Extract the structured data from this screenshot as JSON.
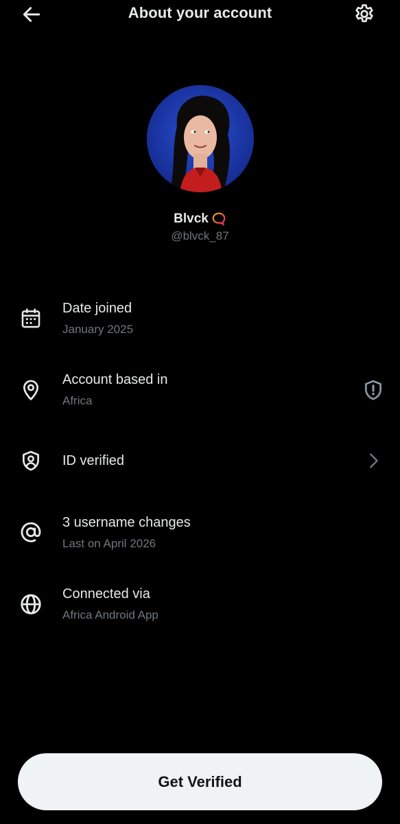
{
  "header": {
    "title": "About your account",
    "back_icon": "arrow-left-icon",
    "settings_icon": "gear-icon"
  },
  "profile": {
    "display_name": "Blvck",
    "name_badge_icon": "speech-bubble-emoji-icon",
    "username": "@blvck_87"
  },
  "details": [
    {
      "icon": "calendar-icon",
      "label": "Date joined",
      "sub": "January 2025"
    },
    {
      "icon": "location-pin-icon",
      "label": "Account based in",
      "sub": "Africa",
      "trailing_icon": "shield-alert-icon"
    },
    {
      "icon": "shield-user-icon",
      "label": "ID verified",
      "trailing_icon": "chevron-right-icon"
    },
    {
      "icon": "at-sign-icon",
      "label": "3 username changes",
      "sub": "Last on April 2026"
    },
    {
      "icon": "globe-icon",
      "label": "Connected via",
      "sub": "Africa Android App"
    }
  ],
  "cta": {
    "label": "Get Verified"
  },
  "colors": {
    "background": "#000000",
    "primary_text": "#e7e9ea",
    "secondary_text": "#71767b",
    "button_bg": "#eff3f4",
    "button_text": "#0f1419",
    "avatar_bg": "#1e3fb0"
  }
}
